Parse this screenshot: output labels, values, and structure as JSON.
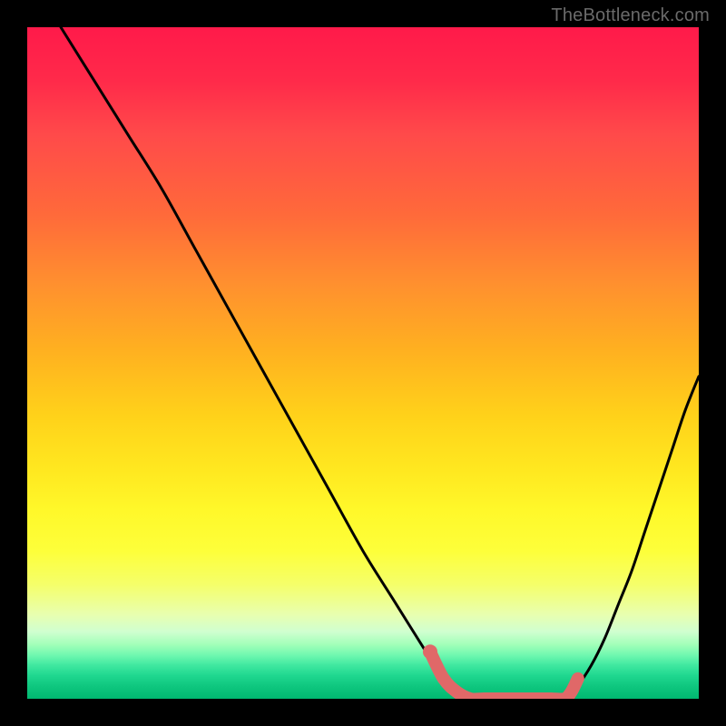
{
  "watermark": "TheBottleneck.com",
  "colors": {
    "background": "#000000",
    "curve": "#000000",
    "highlight": "#e06868",
    "gradient_top": "#ff1a4a",
    "gradient_mid": "#ffe820",
    "gradient_bottom": "#00b870"
  },
  "chart_data": {
    "type": "line",
    "title": "",
    "xlabel": "",
    "ylabel": "",
    "xlim": [
      0,
      100
    ],
    "ylim": [
      0,
      100
    ],
    "series": [
      {
        "name": "bottleneck-curve-left",
        "x": [
          5,
          10,
          15,
          20,
          25,
          30,
          35,
          40,
          45,
          50,
          55,
          60,
          62,
          64,
          66
        ],
        "y": [
          100,
          92,
          84,
          76,
          67,
          58,
          49,
          40,
          31,
          22,
          14,
          6,
          3,
          1,
          0
        ]
      },
      {
        "name": "bottleneck-flat",
        "x": [
          66,
          68,
          70,
          72,
          74,
          76,
          78,
          80
        ],
        "y": [
          0,
          0,
          0,
          0,
          0,
          0,
          0,
          0
        ]
      },
      {
        "name": "bottleneck-curve-right",
        "x": [
          80,
          82,
          84,
          86,
          88,
          90,
          92,
          94,
          96,
          98,
          100
        ],
        "y": [
          0,
          2,
          5,
          9,
          14,
          19,
          25,
          31,
          37,
          43,
          48
        ]
      }
    ],
    "highlight": {
      "name": "optimal-range",
      "x": [
        60,
        62,
        64,
        66,
        68,
        70,
        72,
        74,
        76,
        78,
        80,
        81,
        82
      ],
      "y": [
        7,
        3,
        1,
        0,
        0,
        0,
        0,
        0,
        0,
        0,
        0,
        1,
        3
      ]
    }
  }
}
